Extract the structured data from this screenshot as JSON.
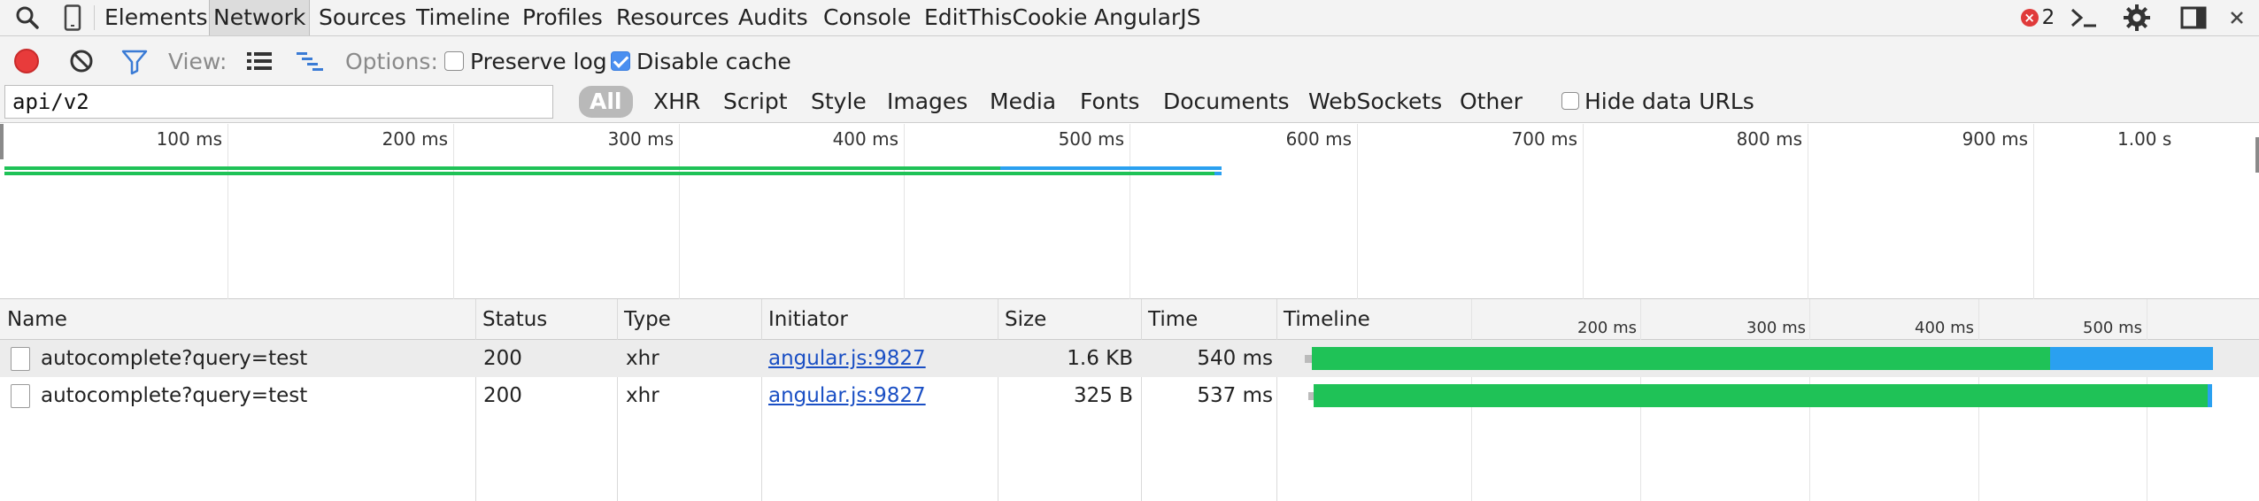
{
  "tabs": [
    "Elements",
    "Network",
    "Sources",
    "Timeline",
    "Profiles",
    "Resources",
    "Audits",
    "Console",
    "EditThisCookie",
    "AngularJS"
  ],
  "active_tab": "Network",
  "error_count": "2",
  "toolbar": {
    "view_label": "View:",
    "options_label": "Options:",
    "preserve_log": "Preserve log",
    "preserve_log_checked": false,
    "disable_cache": "Disable cache",
    "disable_cache_checked": true
  },
  "filter": {
    "value": "api/v2",
    "types": [
      "All",
      "XHR",
      "Script",
      "Style",
      "Images",
      "Media",
      "Fonts",
      "Documents",
      "WebSockets",
      "Other"
    ],
    "selected_type": "All",
    "hide_data_urls": "Hide data URLs",
    "hide_data_urls_checked": false
  },
  "overview": {
    "ticks": [
      "100 ms",
      "200 ms",
      "300 ms",
      "400 ms",
      "500 ms",
      "600 ms",
      "700 ms",
      "800 ms",
      "900 ms",
      "1.00 s"
    ]
  },
  "table": {
    "columns": [
      "Name",
      "Status",
      "Type",
      "Initiator",
      "Size",
      "Time",
      "Timeline"
    ],
    "timeline_ticks": [
      "200 ms",
      "300 ms",
      "400 ms",
      "500 ms"
    ],
    "rows": [
      {
        "name": "autocomplete?query=test",
        "status": "200",
        "type": "xhr",
        "initiator": "angular.js:9827",
        "size": "1.6 KB",
        "time": "540 ms"
      },
      {
        "name": "autocomplete?query=test",
        "status": "200",
        "type": "xhr",
        "initiator": "angular.js:9827",
        "size": "325 B",
        "time": "537 ms"
      }
    ]
  },
  "colors": {
    "waiting": "#1fc257",
    "receiving": "#2aa0f0",
    "record": "#e83b3b",
    "accent": "#4a8ff0"
  }
}
